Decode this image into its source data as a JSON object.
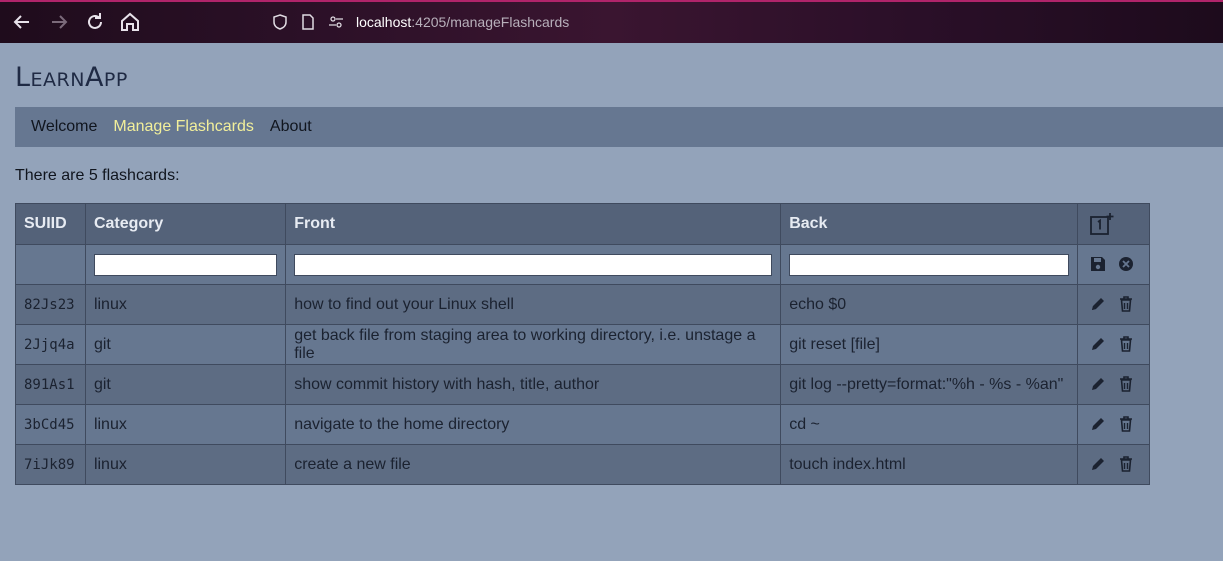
{
  "browser": {
    "url_host": "localhost",
    "url_path": ":4205/manageFlashcards"
  },
  "app": {
    "title": "LearnApp",
    "nav": [
      {
        "label": "Welcome",
        "active": false
      },
      {
        "label": "Manage Flashcards",
        "active": true
      },
      {
        "label": "About",
        "active": false
      }
    ],
    "count_text": "There are 5 flashcards:"
  },
  "table": {
    "headers": [
      "SUIID",
      "Category",
      "Front",
      "Back"
    ],
    "new_row": {
      "category": "",
      "front": "",
      "back": ""
    },
    "rows": [
      {
        "suiid": "82Js23",
        "category": "linux",
        "front": "how to find out your Linux shell",
        "back": "echo $0"
      },
      {
        "suiid": "2Jjq4a",
        "category": "git",
        "front": "get back file from staging area to working directory, i.e. unstage a file",
        "back": "git reset [file]"
      },
      {
        "suiid": "891As1",
        "category": "git",
        "front": "show commit history with hash, title, author",
        "back": "git log --pretty=format:\"%h - %s - %an\""
      },
      {
        "suiid": "3bCd45",
        "category": "linux",
        "front": "navigate to the home directory",
        "back": "cd ~"
      },
      {
        "suiid": "7iJk89",
        "category": "linux",
        "front": "create a new file",
        "back": "touch index.html"
      }
    ]
  },
  "colors": {
    "background": "#93a3ba",
    "navbar": "#667791",
    "nav_active": "#f2ef9b",
    "header": "#546279"
  },
  "icons": {
    "add": "add-card-icon",
    "save": "save-icon",
    "cancel": "cancel-icon",
    "edit": "pencil-icon",
    "delete": "trash-icon"
  }
}
